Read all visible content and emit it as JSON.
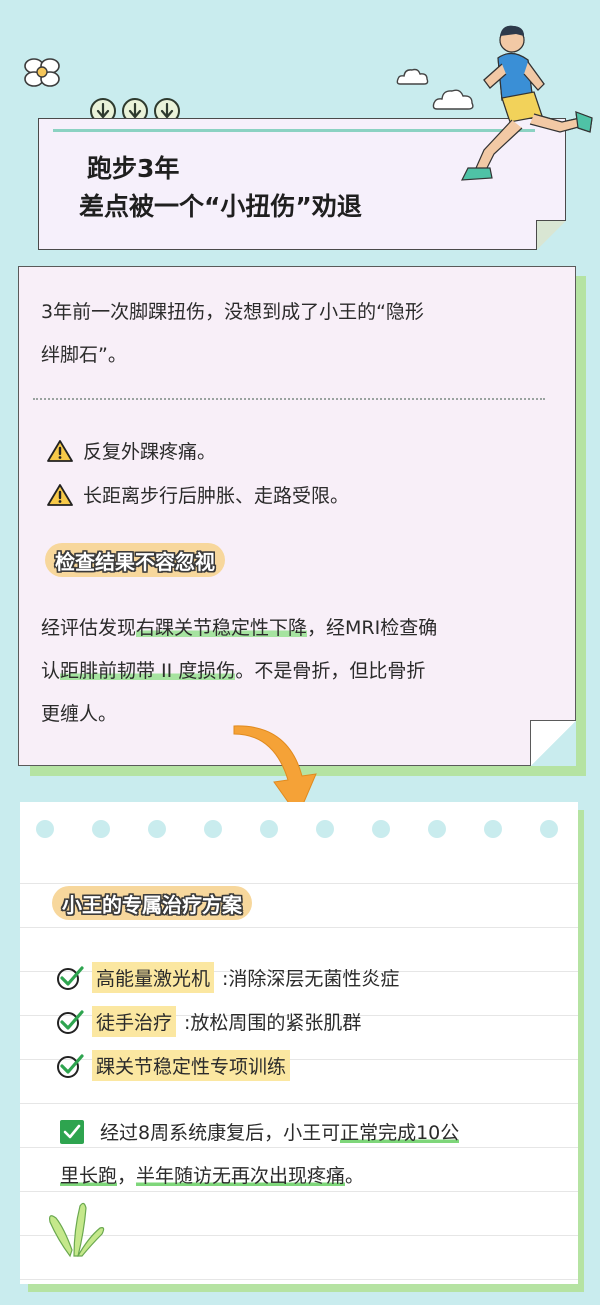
{
  "title": {
    "line1": "跑步3年",
    "line2": "差点被一个“小扭伤”劝退"
  },
  "intro": {
    "line1": "3年前一次脚踝扭伤，没想到成了小王的“隐形",
    "line2": "绊脚石”。"
  },
  "symptoms": [
    "反复外踝疼痛。",
    "长距离步行后肿胀、走路受限。"
  ],
  "exam": {
    "tag": "检查结果不容忽视",
    "line1_a": "经评估发现",
    "line1_hl": "右踝关节稳定性下降",
    "line1_b": "，经MRI检查确",
    "line2_a": "认",
    "line2_hl": "距腓前韧带 II 度损伤",
    "line2_b": "。不是骨折，但比骨折",
    "line3": "更缠人。"
  },
  "plan": {
    "tag": "小王的专属治疗方案",
    "items": [
      {
        "highlight": "高能量激光机",
        "text": ":消除深层无菌性炎症"
      },
      {
        "highlight": "徒手治疗",
        "text": ":放松周围的紧张肌群"
      },
      {
        "highlight": "踝关节稳定性专项训练",
        "text": ""
      }
    ]
  },
  "result": {
    "line1_a": "经过8周系统康复后，小王可",
    "line1_hl": "正常完成10公",
    "line2_hl1": "里长跑",
    "line2_mid": "，",
    "line2_hl2": "半年随访无再次出现疼痛",
    "line2_end": "。"
  },
  "colors": {
    "background": "#c9ecee",
    "card_pink": "#f8eff8",
    "shadow_green": "#b5e3a2",
    "tag_orange": "#f7d79c",
    "highlight_green": "#a6e3a0",
    "highlight_yellow": "#fbe7a1",
    "check_green": "#2ea44f",
    "arrow_orange": "#f5a237"
  },
  "icons": [
    "flower-icon",
    "cloud-icon",
    "runner-illustration",
    "down-arrow-icon",
    "warning-icon",
    "check-circle-icon",
    "checkbox-icon",
    "plant-icon",
    "curved-arrow-icon"
  ]
}
